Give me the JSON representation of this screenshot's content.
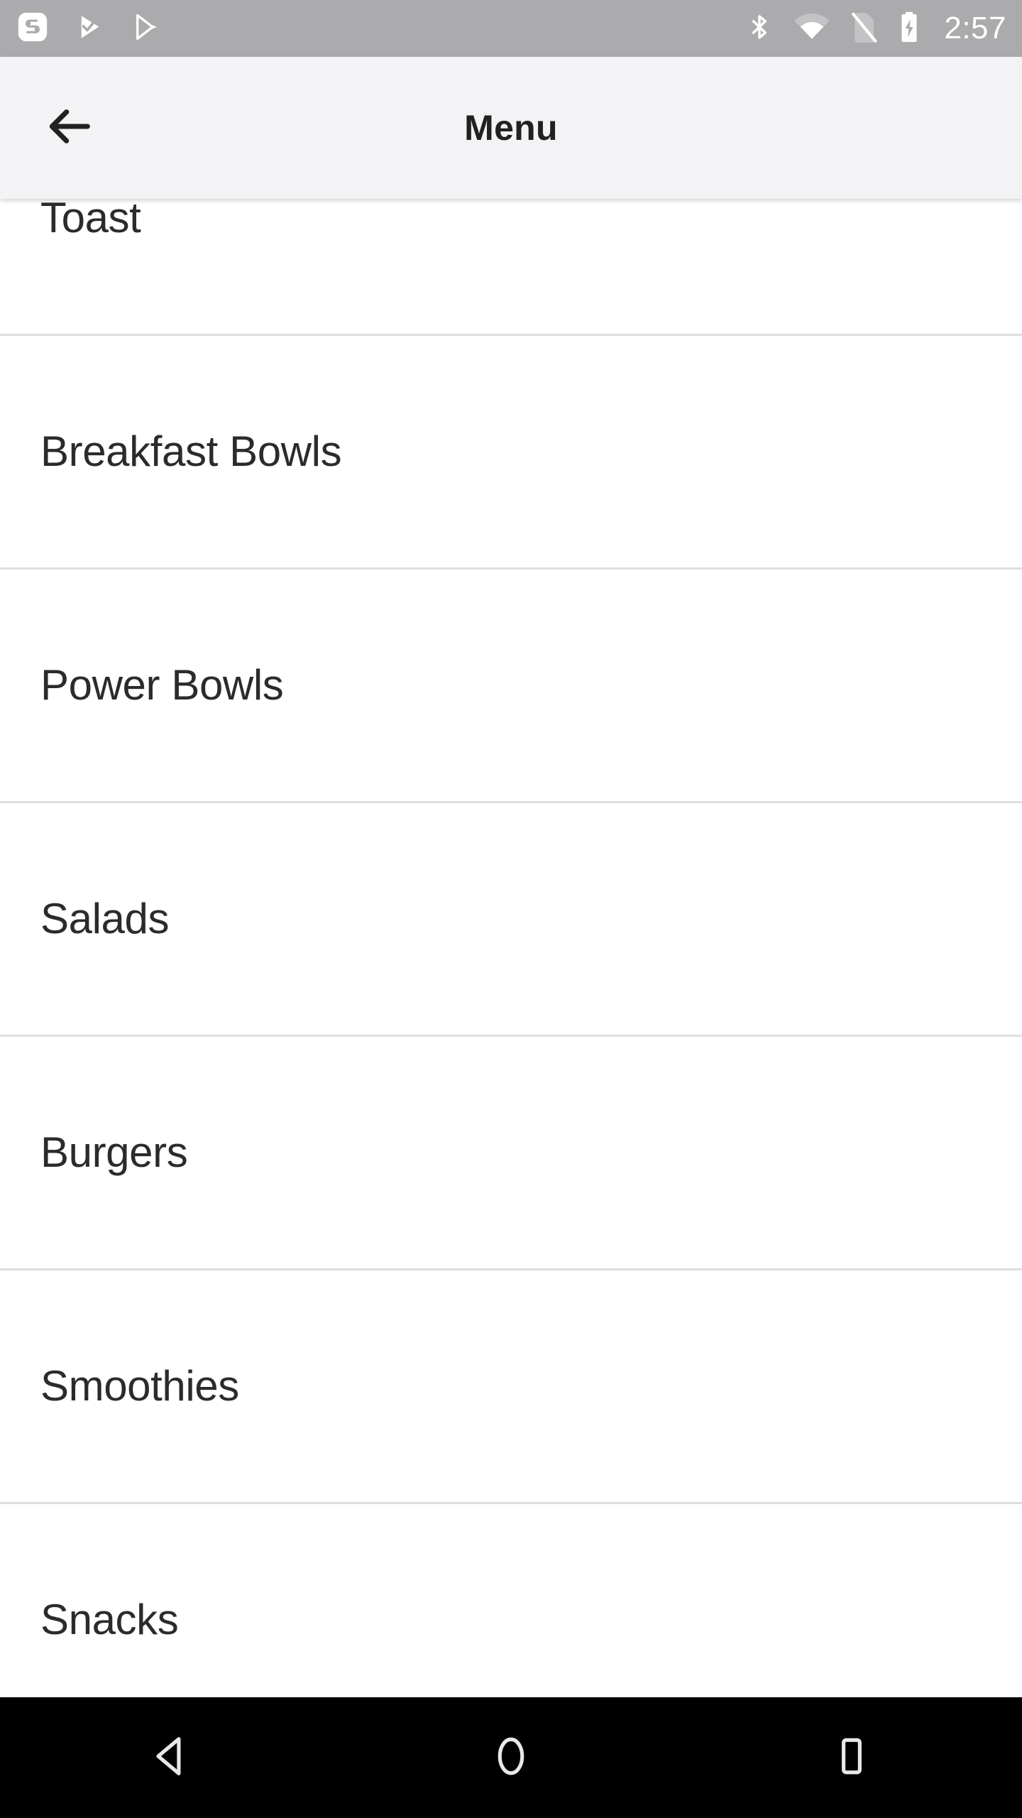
{
  "status_bar": {
    "background_color": "#ababae",
    "notification_icons": [
      {
        "name": "app-logo-s-icon"
      },
      {
        "name": "play-check-icon"
      },
      {
        "name": "google-play-icon"
      }
    ],
    "system_icons": [
      {
        "name": "bluetooth-icon"
      },
      {
        "name": "wifi-icon"
      },
      {
        "name": "no-sim-icon"
      },
      {
        "name": "battery-charging-icon"
      }
    ],
    "clock": "2:57"
  },
  "app_bar": {
    "background_color": "#f3f3f5",
    "back_icon": "arrow-back-icon",
    "title": "Menu",
    "title_color": "#212121"
  },
  "menu": {
    "divider_color": "#dedee1",
    "text_color": "#2b2b2d",
    "items": [
      {
        "label": "Toast"
      },
      {
        "label": "Breakfast Bowls"
      },
      {
        "label": "Power Bowls"
      },
      {
        "label": "Salads"
      },
      {
        "label": "Burgers"
      },
      {
        "label": "Smoothies"
      },
      {
        "label": "Snacks"
      }
    ]
  },
  "nav_bar": {
    "background_color": "#000000",
    "buttons": [
      {
        "name": "nav-back-button",
        "icon": "triangle-back-icon"
      },
      {
        "name": "nav-home-button",
        "icon": "circle-home-icon"
      },
      {
        "name": "nav-recents-button",
        "icon": "square-recents-icon"
      }
    ]
  }
}
